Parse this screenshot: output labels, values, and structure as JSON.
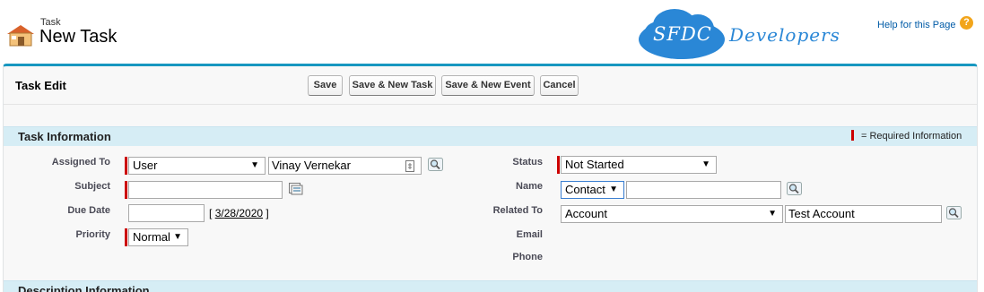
{
  "header": {
    "object_label": "Task",
    "title": "New Task",
    "logo_primary": "SFDC",
    "logo_secondary": "Developers",
    "help_link": "Help for this Page",
    "help_icon_glyph": "?"
  },
  "toolbar": {
    "section_title": "Task Edit",
    "save_label": "Save",
    "save_new_task_label": "Save & New Task",
    "save_new_event_label": "Save & New Event",
    "cancel_label": "Cancel"
  },
  "task_info": {
    "section_title": "Task Information",
    "required_legend": "= Required Information",
    "assigned_to": {
      "label": "Assigned To",
      "type_value": "User",
      "name_value": "Vinay Vernekar"
    },
    "subject": {
      "label": "Subject",
      "value": ""
    },
    "due_date": {
      "label": "Due Date",
      "value": "",
      "today_open": "[",
      "today_link": "3/28/2020",
      "today_close": "]"
    },
    "priority": {
      "label": "Priority",
      "value": "Normal"
    },
    "status": {
      "label": "Status",
      "value": "Not Started"
    },
    "name": {
      "label": "Name",
      "type_value": "Contact",
      "value": ""
    },
    "related_to": {
      "label": "Related To",
      "type_value": "Account",
      "value": "Test Account"
    },
    "email": {
      "label": "Email"
    },
    "phone": {
      "label": "Phone"
    }
  },
  "description": {
    "section_title": "Description Information"
  },
  "colors": {
    "accent": "#1797c0",
    "section_bg": "#d6edf5",
    "required": "#cc0000",
    "link": "#015ba7",
    "help_icon": "#f2a51b"
  },
  "icons": [
    "task-house-icon",
    "help-icon",
    "lookup-icon",
    "combo-icon",
    "subject-picker-icon",
    "dropdown-arrow-icon"
  ]
}
